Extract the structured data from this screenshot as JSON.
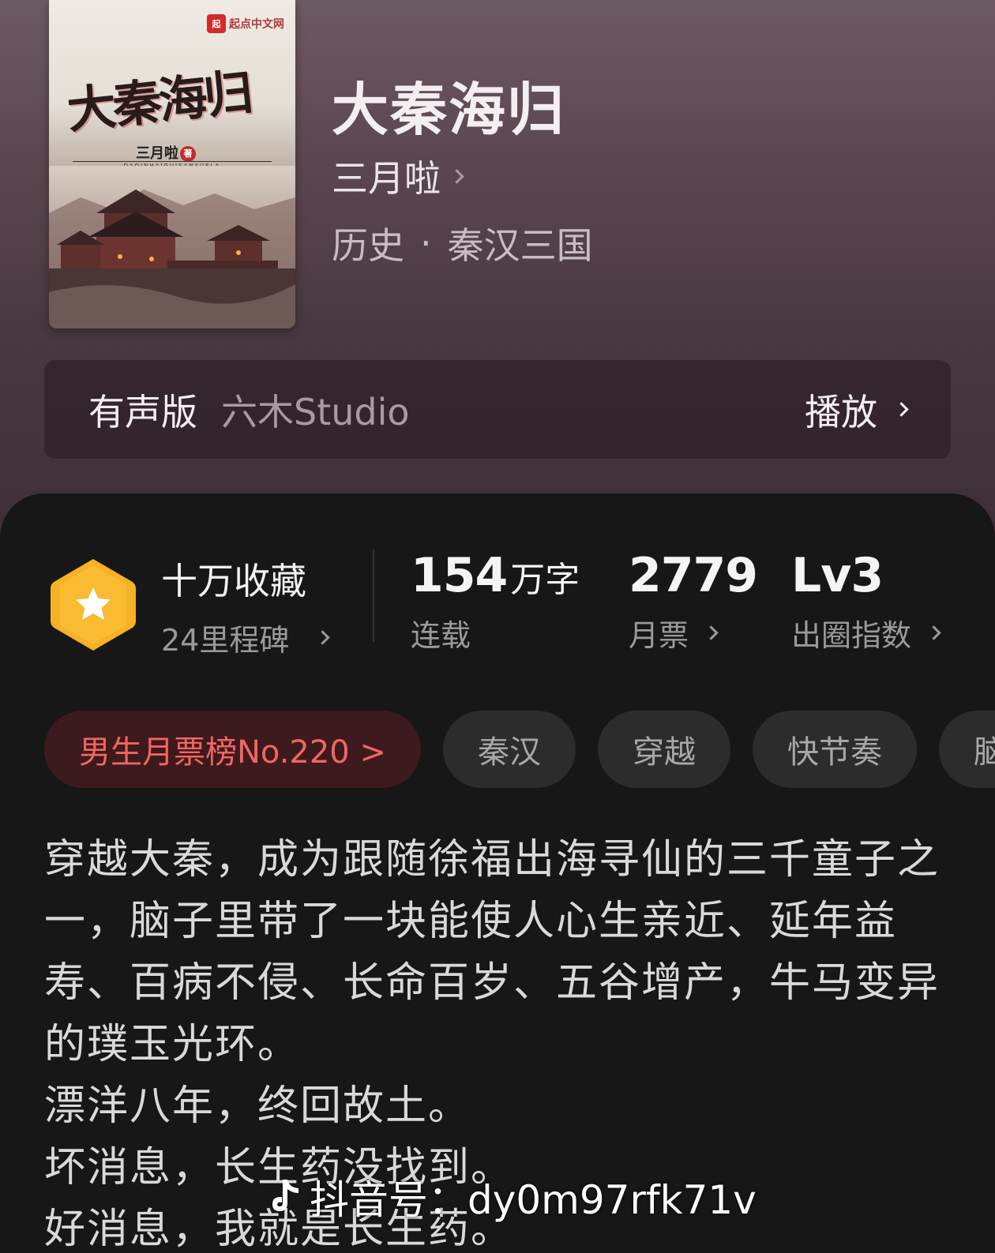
{
  "cover": {
    "publisher": "起点中文网",
    "publisher_mark": "起",
    "title_art": "大秦海归",
    "author_art": "三月啦",
    "seal": "著",
    "pinyin": "DAQINHAIGUISANYUELA"
  },
  "book": {
    "title": "大秦海归",
    "author": "三月啦",
    "genre": "历史",
    "separator": "·",
    "subgenre": "秦汉三国"
  },
  "audio": {
    "label": "有声版",
    "studio": "六木Studio",
    "play": "播放"
  },
  "stats": {
    "collect": "十万收藏",
    "milestone": "24里程碑",
    "words_num": "154",
    "words_unit": "万字",
    "words_label": "连载",
    "votes": "2779",
    "votes_label": "月票",
    "level": "Lv3",
    "level_label": "出圈指数"
  },
  "tags": {
    "rank": "男生月票榜No.220 >",
    "items": [
      "秦汉",
      "穿越",
      "快节奏",
      "脑"
    ]
  },
  "description": [
    "穿越大秦，成为跟随徐福出海寻仙的三千童子之",
    "一，脑子里带了一块能使人心生亲近、延年益",
    "寿、百病不侵、长命百岁、五谷增产，牛马变异",
    "的璞玉光环。",
    "漂洋八年，终回故土。",
    "坏消息，长生药没找到。",
    "好消息，我就是长生药。"
  ],
  "watermark": {
    "icon": "douyin-icon",
    "text": "抖音号：dy0m97rfk71v"
  },
  "colors": {
    "badge": "#f7b125",
    "rank_text": "#f2655f",
    "rank_bg": "#3d1a1d"
  }
}
